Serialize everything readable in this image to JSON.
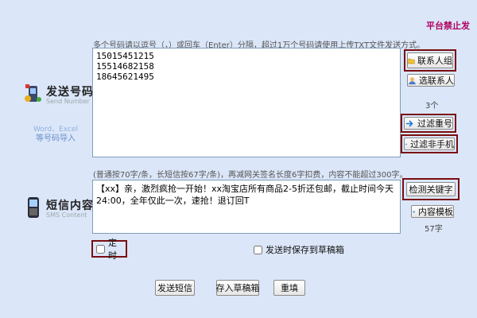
{
  "top_link": "平台禁止发",
  "hint_numbers": "多个号码请以逗号（，）或回车（Enter）分隔，超过1万个号码请使用上传TXT文件发送方式。",
  "numbers_label": {
    "title": "发送号码",
    "subtitle": "Send Number"
  },
  "import_note": {
    "line1": "Word、Excel",
    "line2": "等号码导入"
  },
  "numbers_text": "15015451215\n15514682158\n18645621495",
  "contact_group_button": "联系人组",
  "select_contact_button": "选联系人",
  "number_count": "3个",
  "filter_duplicate_button": "过滤重号",
  "filter_non_mobile_button": "过滤非手机",
  "hint_sms": "(普通按70字/条，长短信按67字/条)，再减网关签名长度6字扣费，内容不能超过300字。",
  "sms_label": {
    "title": "短信内容",
    "subtitle": "SMS Content"
  },
  "sms_text": "【xx】亲，激烈疯抢一开始！xx淘宝店所有商品2-5折还包邮，截止时间今天24:00，全年仅此一次，速抢！退订回T",
  "check_keyword_button": "检测关键字",
  "content_template_button": "内容模板",
  "char_count": "57字",
  "timer_checkbox": {
    "label": "定时",
    "checked": false
  },
  "save_draft_checkbox": {
    "label": "发送时保存到草稿箱",
    "checked": false
  },
  "send_button": "发送短信",
  "draft_button": "存入草稿箱",
  "reset_button": "重填"
}
